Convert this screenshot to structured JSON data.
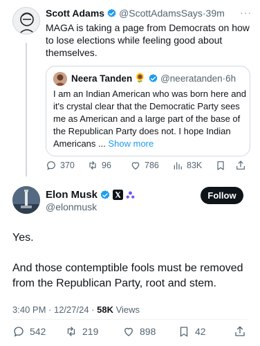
{
  "parent_tweet": {
    "author_name": "Scott Adams",
    "handle": "@ScottAdamsSays",
    "separator": "·",
    "time": "39m",
    "text": "MAGA is taking a page from Democrats on how to lose elections while feeling good about themselves.",
    "more_label": "···",
    "quote": {
      "author_name": "Neera Tanden",
      "emoji": "🌻",
      "handle": "@neeratanden",
      "separator": "·",
      "time": "6h",
      "text": "I am an Indian American who was born here and it's crystal clear that the Democratic Party sees me as American and a large part of the base of the Republican Party does not. I hope Indian Americans ...",
      "show_more": "Show more"
    },
    "stats": {
      "replies": "370",
      "reposts": "96",
      "likes": "786",
      "views": "83K"
    }
  },
  "main_tweet": {
    "author_name": "Elon Musk",
    "handle": "@elonmusk",
    "follow_label": "Follow",
    "text_p1": "Yes.",
    "text_p2": "And those contemptible fools must be removed from the Republican Party, root and stem.",
    "time": "3:40 PM · 12/27/24 · ",
    "views_count": "58K",
    "views_label": " Views",
    "stats": {
      "replies": "542",
      "reposts": "219",
      "likes": "898",
      "bookmarks": "42"
    }
  },
  "colors": {
    "verified_blue": "#1d9bf0",
    "text_primary": "#0f1419",
    "text_muted": "#536471",
    "border": "#cfd9de"
  },
  "icons": [
    "verified-icon",
    "x-affiliate-icon",
    "grok-icon",
    "reply-icon",
    "repost-icon",
    "like-icon",
    "views-icon",
    "bookmark-icon",
    "share-icon"
  ]
}
